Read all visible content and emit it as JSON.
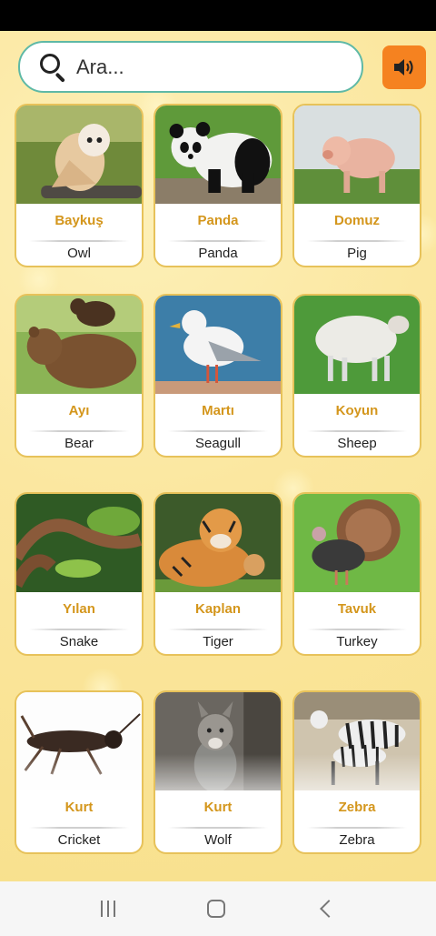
{
  "search": {
    "placeholder": "Ara..."
  },
  "sound_button": {
    "icon": "speaker-icon",
    "color": "#f58220"
  },
  "colors": {
    "accent": "#d4961c",
    "search_border": "#5fb9a6",
    "card_border": "#e7c25a"
  },
  "cards": [
    {
      "tr": "Baykuş",
      "en": "Owl"
    },
    {
      "tr": "Panda",
      "en": "Panda"
    },
    {
      "tr": "Domuz",
      "en": "Pig"
    },
    {
      "tr": "Ayı",
      "en": "Bear"
    },
    {
      "tr": "Martı",
      "en": "Seagull"
    },
    {
      "tr": "Koyun",
      "en": "Sheep"
    },
    {
      "tr": "Yılan",
      "en": "Snake"
    },
    {
      "tr": "Kaplan",
      "en": "Tiger"
    },
    {
      "tr": "Tavuk",
      "en": "Turkey"
    },
    {
      "tr": "Kurt",
      "en": "Cricket"
    },
    {
      "tr": "Kurt",
      "en": "Wolf"
    },
    {
      "tr": "Zebra",
      "en": "Zebra"
    }
  ],
  "nav": {
    "recents_icon": "recents-icon",
    "home_icon": "home-icon",
    "back_icon": "back-icon"
  }
}
